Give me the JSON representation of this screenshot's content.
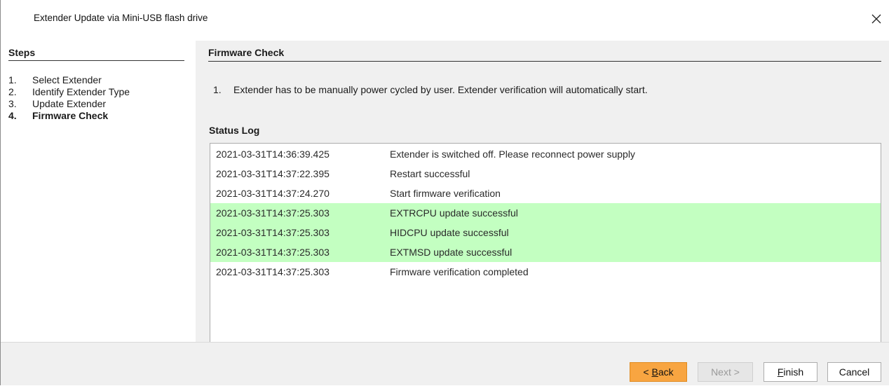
{
  "window": {
    "title": "Extender Update via Mini-USB flash drive",
    "close_icon": "close-icon"
  },
  "sidebar": {
    "header": "Steps",
    "steps": [
      {
        "num": "1.",
        "label": "Select Extender"
      },
      {
        "num": "2.",
        "label": "Identify Extender Type"
      },
      {
        "num": "3.",
        "label": "Update Extender"
      },
      {
        "num": "4.",
        "label": "Firmware Check",
        "active": true
      }
    ]
  },
  "content": {
    "header": "Firmware Check",
    "instruction_num": "1.",
    "instruction": "Extender has to be manually power cycled by user. Extender verification will automatically start.",
    "log_label": "Status Log",
    "log": [
      {
        "timestamp": "2021-03-31T14:36:39.425",
        "message": "Extender is switched off. Please reconnect power supply",
        "status": "info"
      },
      {
        "timestamp": "2021-03-31T14:37:22.395",
        "message": "Restart successful",
        "status": "info"
      },
      {
        "timestamp": "2021-03-31T14:37:24.270",
        "message": "Start firmware verification",
        "status": "info"
      },
      {
        "timestamp": "2021-03-31T14:37:25.303",
        "message": "EXTRCPU update successful",
        "status": "success"
      },
      {
        "timestamp": "2021-03-31T14:37:25.303",
        "message": "HIDCPU update successful",
        "status": "success"
      },
      {
        "timestamp": "2021-03-31T14:37:25.303",
        "message": "EXTMSD update successful",
        "status": "success"
      },
      {
        "timestamp": "2021-03-31T14:37:25.303",
        "message": "Firmware verification completed",
        "status": "info"
      }
    ]
  },
  "footer": {
    "back_label": "< Back",
    "next_label": "Next >",
    "finish_label": "Finish",
    "cancel_label": "Cancel"
  },
  "colors": {
    "success_row": "#c3ffc1",
    "back_button": "#f8a541",
    "content_bg": "#f0f0f0"
  }
}
